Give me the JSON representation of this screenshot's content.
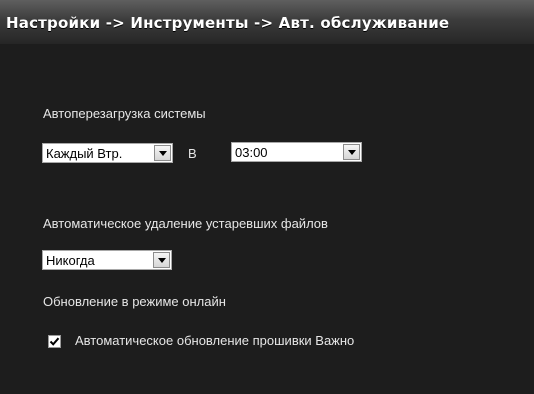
{
  "header": {
    "title": "Настройки -> Инструменты -> Авт. обслуживание"
  },
  "reboot": {
    "label": "Автоперезагрузка системы",
    "day_value": "Каждый Втр.",
    "at_label": "В",
    "time_value": "03:00"
  },
  "delete_old": {
    "label": "Автоматическое удаление устаревших файлов",
    "value": "Никогда"
  },
  "online_update": {
    "label": "Обновление в режиме онлайн",
    "checkbox_label": "Автоматическое обновление прошивки Важно",
    "checked": true
  },
  "icons": {
    "dropdown": "chevron-down-icon",
    "check": "check-icon"
  }
}
